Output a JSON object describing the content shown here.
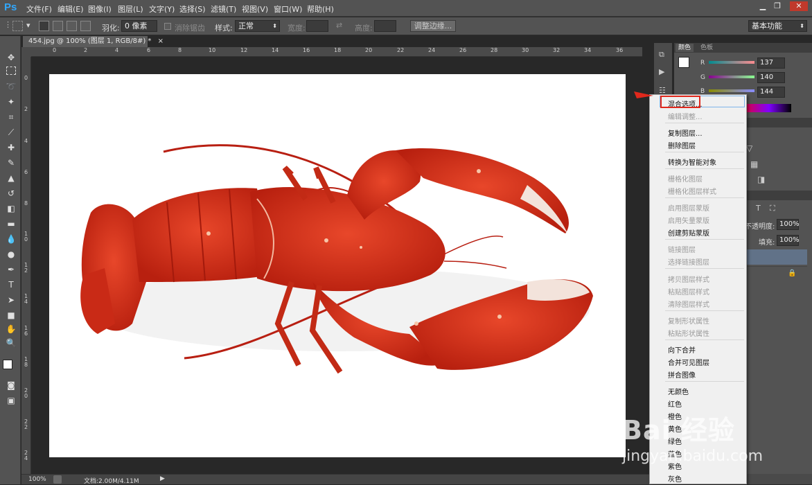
{
  "app": {
    "logo": "Ps"
  },
  "menu": [
    "文件(F)",
    "编辑(E)",
    "图像(I)",
    "图层(L)",
    "文字(Y)",
    "选择(S)",
    "滤镜(T)",
    "视图(V)",
    "窗口(W)",
    "帮助(H)"
  ],
  "window_controls": [
    "▁",
    "❐",
    "✕"
  ],
  "options": {
    "feather_label": "羽化:",
    "feather_value": "0 像素",
    "antialias_label": "消除锯齿",
    "style_label": "样式:",
    "style_value": "正常",
    "width_label": "宽度:",
    "height_label": "高度:",
    "refine_button": "调整边缘...",
    "workspace": "基本功能"
  },
  "document": {
    "tab_title": "454.jpg @ 100% (图层 1, RGB/8#) *",
    "zoom": "100%",
    "doc_size": "文档:2.00M/4.11M"
  },
  "ruler_top": [
    "0",
    "2",
    "4",
    "6",
    "8",
    "10",
    "12",
    "14",
    "16",
    "18",
    "20",
    "22",
    "24",
    "26",
    "28",
    "30",
    "32",
    "34",
    "36"
  ],
  "ruler_left": [
    "0",
    "2",
    "4",
    "6",
    "8",
    "1\n0",
    "1\n2",
    "1\n4",
    "1\n6",
    "1\n8",
    "2\n0",
    "2\n2",
    "2\n4"
  ],
  "color_panel": {
    "tab_color": "颜色",
    "tab_swatches": "色板",
    "r_label": "R",
    "g_label": "G",
    "b_label": "B",
    "r_value": "137",
    "g_value": "140",
    "b_value": "144"
  },
  "layers_panel": {
    "opacity_label": "不透明度:",
    "opacity_value": "100%",
    "fill_label": "填充:",
    "fill_value": "100%"
  },
  "context_menu": {
    "items": [
      {
        "label": "混合选项...",
        "disabled": false
      },
      {
        "label": "编辑调整...",
        "disabled": true
      },
      {
        "label": "复制图层...",
        "disabled": false
      },
      {
        "label": "删除图层",
        "disabled": false
      },
      {
        "label": "转换为智能对象",
        "disabled": false
      },
      {
        "label": "栅格化图层",
        "disabled": true
      },
      {
        "label": "栅格化图层样式",
        "disabled": true
      },
      {
        "label": "启用图层蒙版",
        "disabled": true
      },
      {
        "label": "启用矢量蒙版",
        "disabled": true
      },
      {
        "label": "创建剪贴蒙版",
        "disabled": false
      },
      {
        "label": "链接图层",
        "disabled": true
      },
      {
        "label": "选择链接图层",
        "disabled": true
      },
      {
        "label": "拷贝图层样式",
        "disabled": true
      },
      {
        "label": "粘贴图层样式",
        "disabled": true
      },
      {
        "label": "清除图层样式",
        "disabled": true
      },
      {
        "label": "复制形状属性",
        "disabled": true
      },
      {
        "label": "粘贴形状属性",
        "disabled": true
      },
      {
        "label": "向下合并",
        "disabled": false
      },
      {
        "label": "合并可见图层",
        "disabled": false
      },
      {
        "label": "拼合图像",
        "disabled": false
      },
      {
        "label": "无颜色",
        "disabled": false
      },
      {
        "label": "红色",
        "disabled": false
      },
      {
        "label": "橙色",
        "disabled": false
      },
      {
        "label": "黄色",
        "disabled": false
      },
      {
        "label": "绿色",
        "disabled": false
      },
      {
        "label": "蓝色",
        "disabled": false
      },
      {
        "label": "紫色",
        "disabled": false
      },
      {
        "label": "灰色",
        "disabled": false
      }
    ]
  },
  "watermark": {
    "brand": "Bai 经验",
    "url": "jingyan.baidu.com"
  },
  "colors": {
    "accent": "#31a8ff",
    "highlight_border": "#e0281c",
    "lobster": "#d9301c"
  }
}
